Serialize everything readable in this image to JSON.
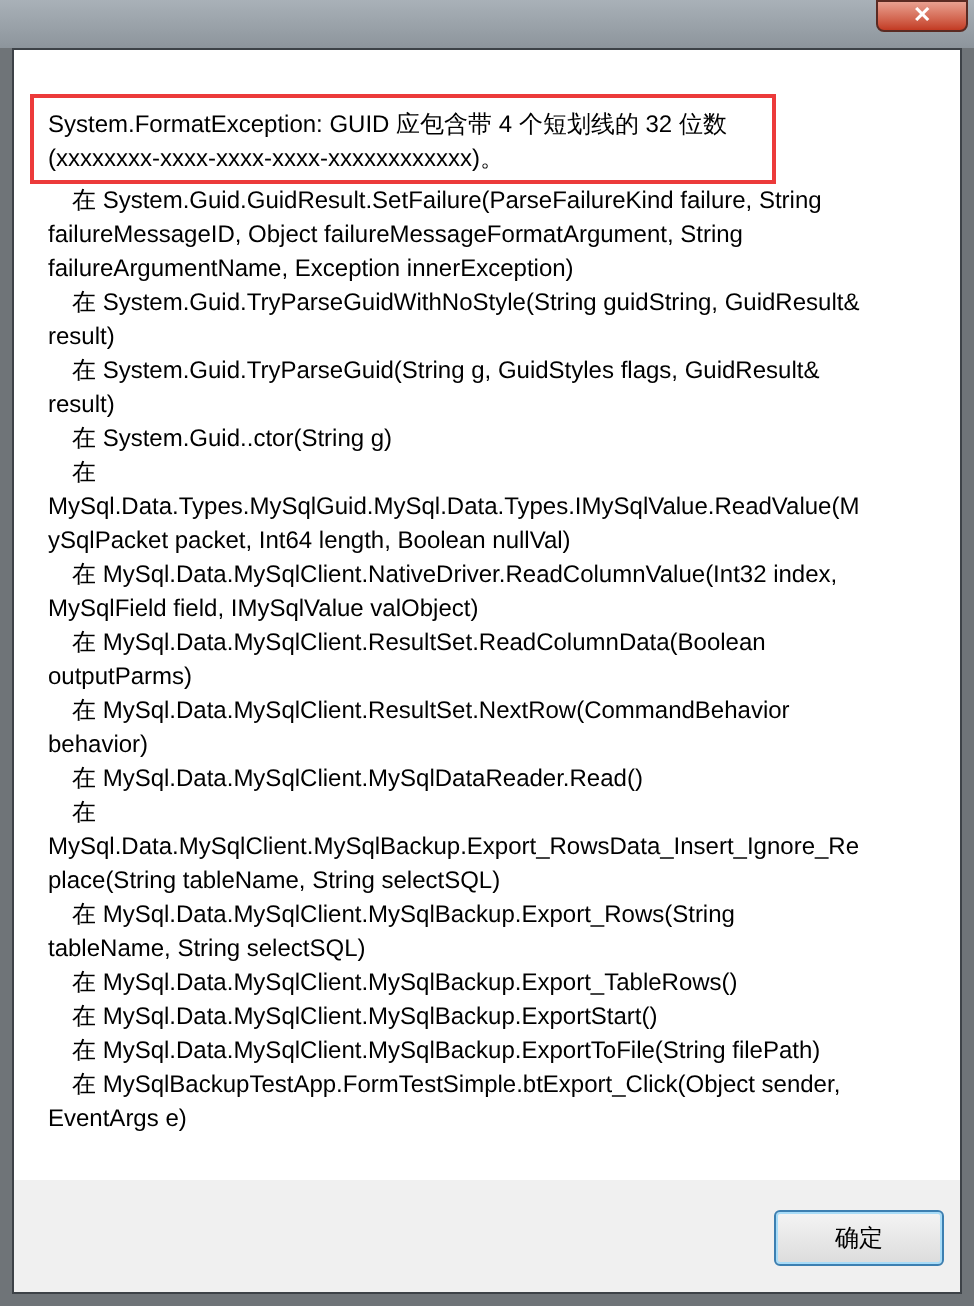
{
  "window": {
    "close_label": "✕"
  },
  "message": {
    "highlighted": true,
    "lines": [
      "System.FormatException: GUID 应包含带 4 个短划线的 32 位数",
      "(xxxxxxxx-xxxx-xxxx-xxxx-xxxxxxxxxxxx)。"
    ]
  },
  "stack_trace": [
    {
      "indent": true,
      "text": "在 System.Guid.GuidResult.SetFailure(ParseFailureKind failure, String"
    },
    {
      "indent": false,
      "text": "failureMessageID, Object failureMessageFormatArgument, String"
    },
    {
      "indent": false,
      "text": "failureArgumentName, Exception innerException)"
    },
    {
      "indent": true,
      "text": "在 System.Guid.TryParseGuidWithNoStyle(String guidString, GuidResult&"
    },
    {
      "indent": false,
      "text": "result)"
    },
    {
      "indent": true,
      "text": "在 System.Guid.TryParseGuid(String g, GuidStyles flags, GuidResult&"
    },
    {
      "indent": false,
      "text": "result)"
    },
    {
      "indent": true,
      "text": "在 System.Guid..ctor(String g)"
    },
    {
      "indent": true,
      "text": "在"
    },
    {
      "indent": false,
      "text": "MySql.Data.Types.MySqlGuid.MySql.Data.Types.IMySqlValue.ReadValue(M"
    },
    {
      "indent": false,
      "text": "ySqlPacket packet, Int64 length, Boolean nullVal)"
    },
    {
      "indent": true,
      "text": "在 MySql.Data.MySqlClient.NativeDriver.ReadColumnValue(Int32 index,"
    },
    {
      "indent": false,
      "text": "MySqlField field, IMySqlValue valObject)"
    },
    {
      "indent": true,
      "text": "在 MySql.Data.MySqlClient.ResultSet.ReadColumnData(Boolean"
    },
    {
      "indent": false,
      "text": "outputParms)"
    },
    {
      "indent": true,
      "text": "在 MySql.Data.MySqlClient.ResultSet.NextRow(CommandBehavior"
    },
    {
      "indent": false,
      "text": "behavior)"
    },
    {
      "indent": true,
      "text": "在 MySql.Data.MySqlClient.MySqlDataReader.Read()"
    },
    {
      "indent": true,
      "text": "在"
    },
    {
      "indent": false,
      "text": "MySql.Data.MySqlClient.MySqlBackup.Export_RowsData_Insert_Ignore_Re"
    },
    {
      "indent": false,
      "text": "place(String tableName, String selectSQL)"
    },
    {
      "indent": true,
      "text": "在 MySql.Data.MySqlClient.MySqlBackup.Export_Rows(String"
    },
    {
      "indent": false,
      "text": "tableName, String selectSQL)"
    },
    {
      "indent": true,
      "text": "在 MySql.Data.MySqlClient.MySqlBackup.Export_TableRows()"
    },
    {
      "indent": true,
      "text": "在 MySql.Data.MySqlClient.MySqlBackup.ExportStart()"
    },
    {
      "indent": true,
      "text": "在 MySql.Data.MySqlClient.MySqlBackup.ExportToFile(String filePath)"
    },
    {
      "indent": true,
      "text": "在 MySqlBackupTestApp.FormTestSimple.btExport_Click(Object sender,"
    },
    {
      "indent": false,
      "text": "EventArgs e)"
    }
  ],
  "buttons": [
    {
      "label": "确定",
      "selected": true
    }
  ]
}
